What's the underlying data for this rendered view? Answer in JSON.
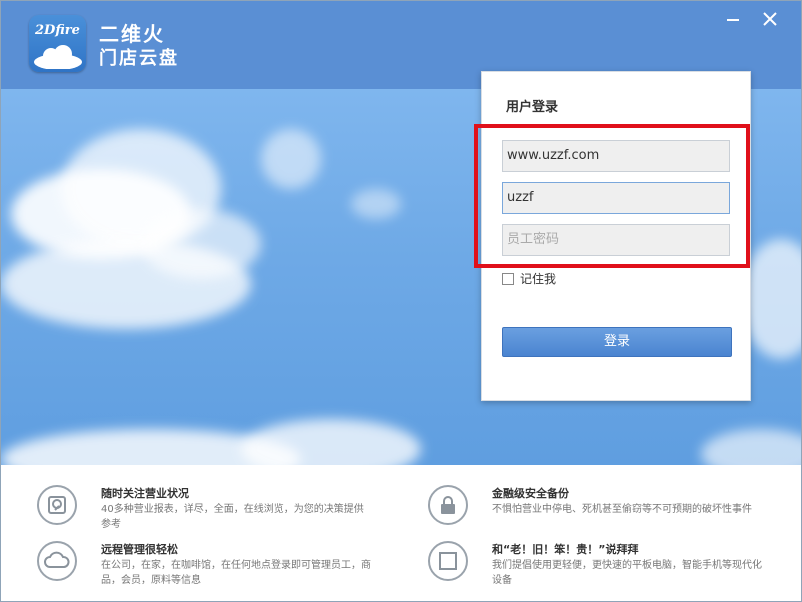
{
  "header": {
    "logo_text": "2Dfire",
    "app_name": "二维火",
    "app_subtitle": "门店云盘",
    "minimize_icon": "minimize-icon",
    "close_icon": "close-icon",
    "brand_color": "#5a8fd4"
  },
  "login": {
    "title": "用户登录",
    "username_value": "www.uzzf.com",
    "password_value": "uzzf",
    "staff_placeholder": "员工密码",
    "remember_label": "记住我",
    "submit_label": "登录",
    "highlight_color": "#e0101a"
  },
  "features": [
    {
      "icon": "disk-icon",
      "title": "随时关注营业状况",
      "desc": "40多种营业报表，详尽，全面，在线浏览，为您的决策提供参考"
    },
    {
      "icon": "lock-icon",
      "title": "金融级安全备份",
      "desc": "不惧怕营业中停电、死机甚至偷窃等不可预期的破坏性事件"
    },
    {
      "icon": "cloud-icon",
      "title": "远程管理很轻松",
      "desc": "在公司，在家，在咖啡馆，在任何地点登录即可管理员工，商品，会员，原料等信息"
    },
    {
      "icon": "device-icon",
      "title": "和“老！旧！笨！贵！”说拜拜",
      "desc": "我们提倡使用更轻便，更快速的平板电脑，智能手机等现代化设备"
    }
  ]
}
